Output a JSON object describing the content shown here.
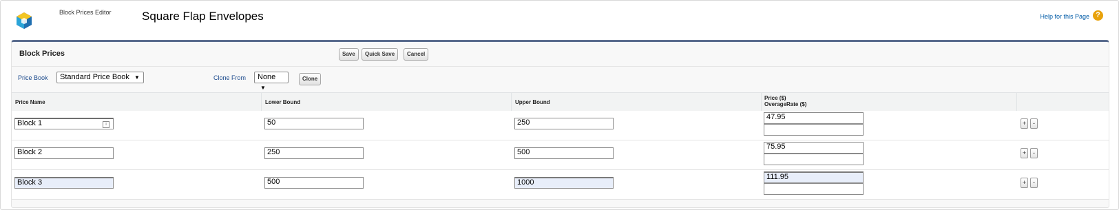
{
  "header": {
    "breadcrumb": "Block Prices Editor",
    "title": "Square Flap Envelopes",
    "help_link": "Help for this Page",
    "help_icon": "?"
  },
  "panel": {
    "title": "Block Prices",
    "buttons": {
      "save": "Save",
      "quick_save": "Quick Save",
      "cancel": "Cancel"
    }
  },
  "controls": {
    "price_book_label": "Price Book",
    "price_book_value": "Standard Price Book",
    "clone_from_label": "Clone From",
    "clone_from_value": "None",
    "clone_button": "Clone",
    "dropdown_arrow": "▼"
  },
  "table": {
    "headers": {
      "price_name": "Price Name",
      "lower_bound": "Lower Bound",
      "upper_bound": "Upper Bound",
      "price": "Price ($)",
      "overage": "OverageRate ($)"
    },
    "rows": [
      {
        "name": "Block 1",
        "lower": "50",
        "upper": "250",
        "price": "47.95",
        "overage": ""
      },
      {
        "name": "Block 2",
        "lower": "250",
        "upper": "500",
        "price": "75.95",
        "overage": ""
      },
      {
        "name": "Block 3",
        "lower": "500",
        "upper": "1000",
        "price": "111.95",
        "overage": ""
      }
    ],
    "add_label": "+",
    "remove_label": "-"
  },
  "colors": {
    "panel_border": "#5a6c8e",
    "link": "#015ba7",
    "help_icon": "#e8a20c"
  }
}
